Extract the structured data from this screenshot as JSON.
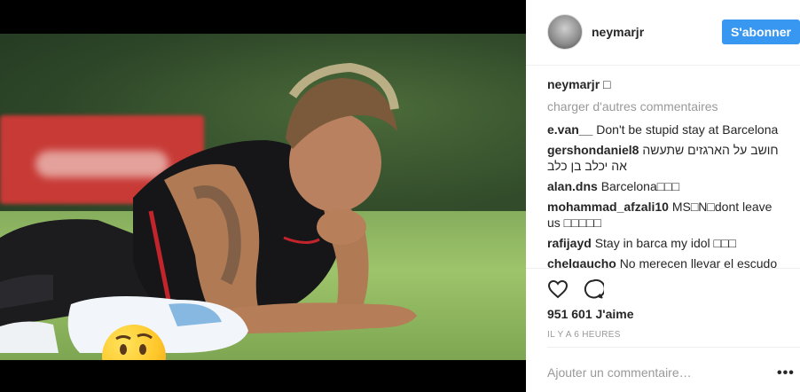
{
  "post": {
    "author": "neymarjr",
    "follow_label": "S'abonner",
    "caption_user": "neymarjr",
    "caption_text": "□",
    "load_more": "charger d'autres commentaires",
    "comments": [
      {
        "user": "e.van__",
        "text": "Don't be stupid stay at Barcelona",
        "rtl": false
      },
      {
        "user": "gershondaniel8",
        "text": "חושב על הארגזים שתעשה אה יכלב בן כלב",
        "rtl": true
      },
      {
        "user": "alan.dns",
        "text": "Barcelona□□□",
        "rtl": false
      },
      {
        "user": "mohammad_afzali10",
        "text": "MS□N□dont leave us □□□□□",
        "rtl": false
      },
      {
        "user": "rafijayd",
        "text": "Stay in barca my idol □□□",
        "rtl": false
      },
      {
        "user": "chelgaucho",
        "text": "No merecen llevar el escudo",
        "rtl": false
      }
    ],
    "likes": "951 601 J'aime",
    "time": "IL Y A 6 HEURES",
    "add_comment_placeholder": "Ajouter un commentaire…",
    "more_label": "•••",
    "icons": {
      "like": "heart-icon",
      "comment": "comment-icon",
      "more": "more-options-icon"
    }
  },
  "colors": {
    "accent": "#3897f0",
    "muted": "#999999",
    "text": "#262626"
  }
}
